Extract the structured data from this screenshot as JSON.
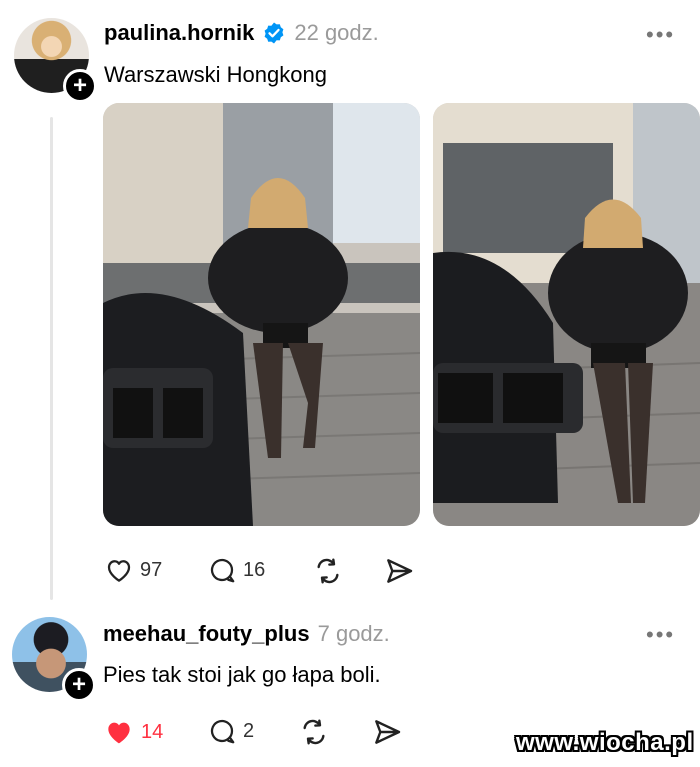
{
  "post": {
    "username": "paulina.hornik",
    "time": "22 godz.",
    "text": "Warszawski Hongkong",
    "more": "•••",
    "likes": "97",
    "comments": "16"
  },
  "reply": {
    "username": "meehau_fouty_plus",
    "time": "7 godz.",
    "text": "Pies tak stoi jak go łapa boli.",
    "more": "•••",
    "likes": "14",
    "comments": "2",
    "liked": true
  },
  "colors": {
    "verified": "#0095f6",
    "like_active": "#ff3040",
    "muted": "#9a9a9a"
  },
  "watermark": "www.wiocha.pl"
}
